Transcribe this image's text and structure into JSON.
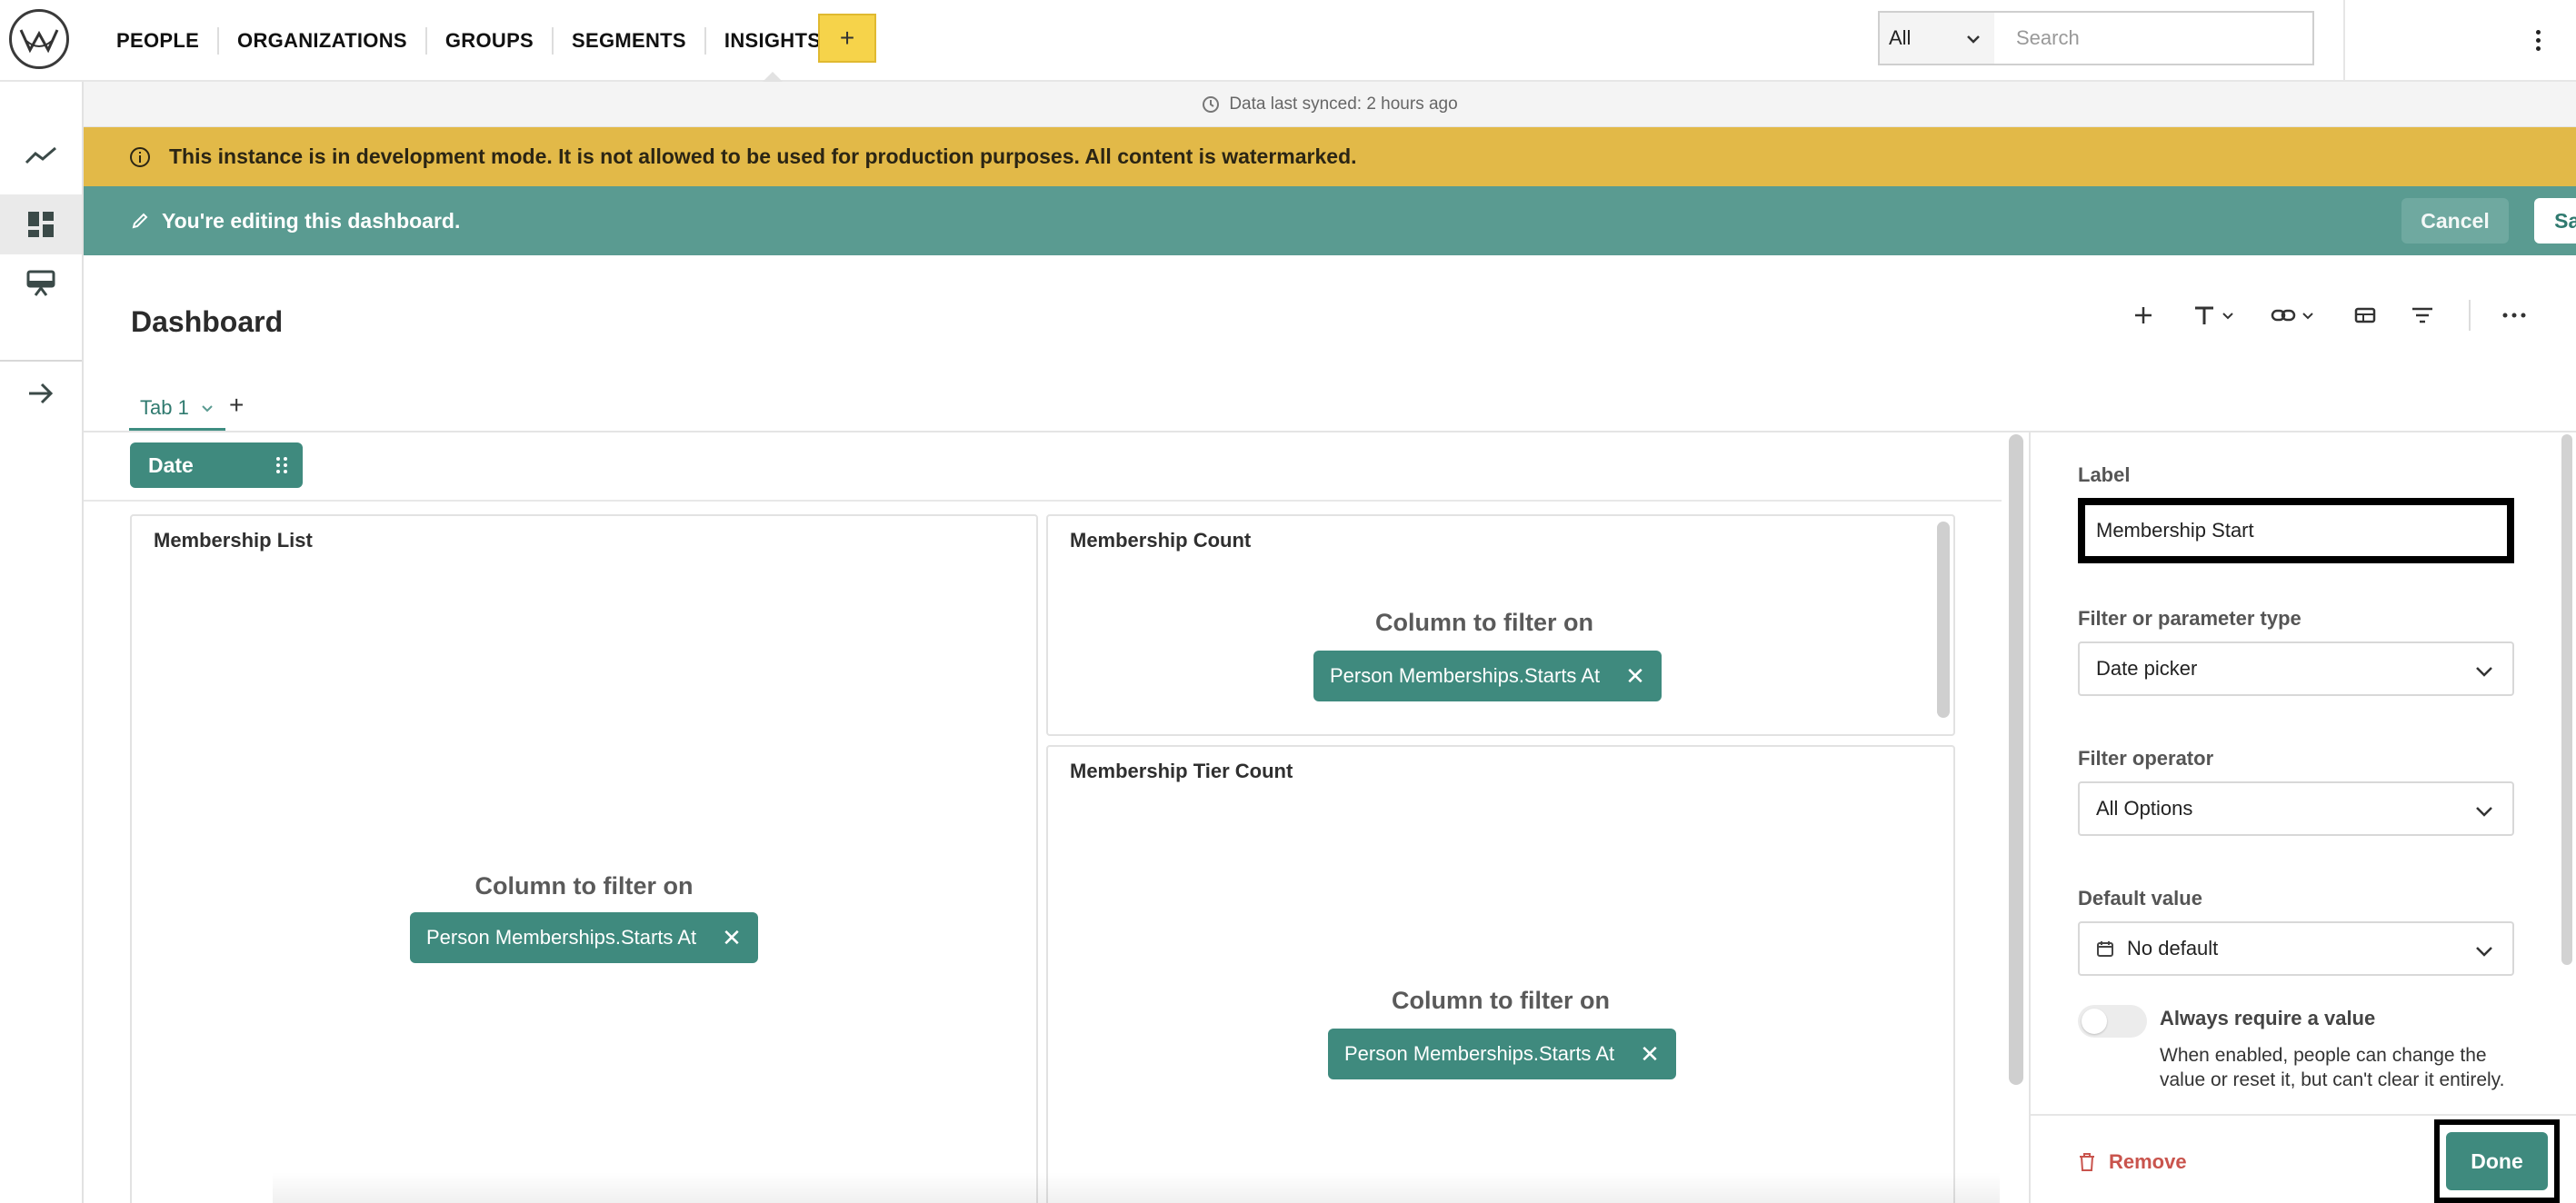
{
  "nav": {
    "items": [
      {
        "label": "PEOPLE"
      },
      {
        "label": "ORGANIZATIONS"
      },
      {
        "label": "GROUPS"
      },
      {
        "label": "SEGMENTS"
      },
      {
        "label": "INSIGHTS",
        "active": true
      }
    ],
    "add_label": "+",
    "scope_value": "All",
    "search_placeholder": "Search"
  },
  "sync": {
    "text": "Data last synced: 2 hours ago"
  },
  "dev_banner": {
    "text": "This instance is in development mode. It is not allowed to be used for production purposes. All content is watermarked."
  },
  "edit_banner": {
    "text": "You're editing this dashboard.",
    "cancel_label": "Cancel",
    "save_label": "Save"
  },
  "dashboard": {
    "title": "Dashboard",
    "tabs": [
      {
        "label": "Tab 1"
      }
    ],
    "tab_add": "+",
    "filter_chip": "Date"
  },
  "cards": {
    "membership_list": {
      "title": "Membership List",
      "column_label": "Column to filter on",
      "column_value": "Person Memberships.Starts At"
    },
    "membership_count": {
      "title": "Membership Count",
      "column_label": "Column to filter on",
      "column_value": "Person Memberships.Starts At"
    },
    "membership_tier_count": {
      "title": "Membership Tier Count",
      "column_label": "Column to filter on",
      "column_value": "Person Memberships.Starts At"
    }
  },
  "panel": {
    "label_heading": "Label",
    "label_value": "Membership Start",
    "type_heading": "Filter or parameter type",
    "type_value": "Date picker",
    "operator_heading": "Filter operator",
    "operator_value": "All Options",
    "default_heading": "Default value",
    "default_value": "No default",
    "toggle_label": "Always require a value",
    "toggle_on": false,
    "toggle_help": "When enabled, people can change the value or reset it, but can't clear it entirely.",
    "remove_label": "Remove",
    "done_label": "Done"
  },
  "colors": {
    "brand_teal": "#3f8a7e",
    "edit_bar": "#5a9b91",
    "dev_banner": "#e2b948",
    "add_button": "#f6d34a",
    "danger": "#c9544d"
  },
  "icons": [
    "logo-icon",
    "info-icon",
    "pencil-icon",
    "clock-icon",
    "chart-line-icon",
    "dashboard-icon",
    "presentation-icon",
    "arrow-right-icon",
    "plus-icon",
    "text-icon",
    "link-icon",
    "section-icon",
    "filter-icon",
    "more-icon",
    "chevron-down-icon",
    "close-icon",
    "calendar-icon",
    "trash-icon",
    "grip-icon"
  ]
}
